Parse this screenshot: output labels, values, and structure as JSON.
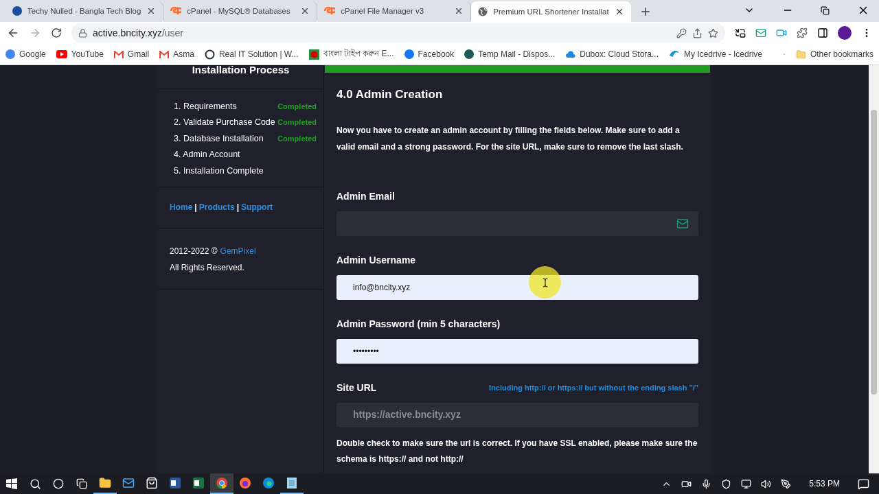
{
  "browser": {
    "tabs": [
      {
        "title": "Techy Nulled - Bangla Tech Blog",
        "selected": false
      },
      {
        "title": "cPanel - MySQL® Databases",
        "selected": false
      },
      {
        "title": "cPanel File Manager v3",
        "selected": false
      },
      {
        "title": "Premium URL Shortener Installat",
        "selected": true
      }
    ],
    "address": {
      "host": "active.bncity.xyz",
      "path": "/user"
    },
    "bookmarks": [
      {
        "label": "Google"
      },
      {
        "label": "YouTube"
      },
      {
        "label": "Gmail"
      },
      {
        "label": "Asma"
      },
      {
        "label": "Real IT Solution | W..."
      },
      {
        "label": "বাংলা টাইপ করুন E..."
      },
      {
        "label": "Facebook"
      },
      {
        "label": "Temp Mail - Dispos..."
      },
      {
        "label": "Dubox: Cloud Stora..."
      },
      {
        "label": "My Icedrive - Icedrive"
      }
    ],
    "other_bookmarks": "Other bookmarks"
  },
  "sidebar": {
    "title": "Installation Process",
    "steps": [
      {
        "label": "1. Requirements",
        "status": "Completed"
      },
      {
        "label": "2. Validate Purchase Code",
        "status": "Completed"
      },
      {
        "label": "3. Database Installation",
        "status": "Completed"
      },
      {
        "label": "4. Admin Account"
      },
      {
        "label": "5. Installation Complete"
      }
    ],
    "links": [
      "Home",
      "Products",
      "Support"
    ],
    "link_separators": [
      "|",
      "|"
    ],
    "copyright": "2012-2022 ©",
    "company": "GemPixel",
    "rights": "All Rights Reserved."
  },
  "main": {
    "heading": "4.0 Admin Creation",
    "description": "Now you have to create an admin account by filling the fields below. Make sure to add a valid email and a strong password. For the site URL, make sure to remove the last slash.",
    "fields": [
      {
        "label": "Admin Email",
        "kind": "email"
      },
      {
        "label": "Admin Username",
        "kind": "text",
        "value": "info@bncity.xyz"
      },
      {
        "label": "Admin Password (min 5 characters)",
        "kind": "password",
        "value": "•••••••••"
      },
      {
        "label": "Site URL",
        "kind": "url",
        "placeholder": "https://active.bncity.xyz",
        "hint": "Including http:// or https:// but without the ending slash \"/\""
      }
    ],
    "note": "Double check to make sure the url is correct. If you have SSL enabled, please make sure the schema is https:// and not http://"
  },
  "taskbar": {
    "apps": [
      {
        "running": true,
        "selected": false
      },
      {
        "running": false,
        "selected": false
      },
      {
        "running": false,
        "selected": false
      },
      {
        "running": false,
        "selected": false
      },
      {
        "running": false,
        "selected": false
      },
      {
        "running": true,
        "selected": true
      },
      {
        "running": false,
        "selected": false
      },
      {
        "running": false,
        "selected": false
      },
      {
        "running": true,
        "selected": false
      }
    ],
    "clock": "5:53 PM"
  }
}
